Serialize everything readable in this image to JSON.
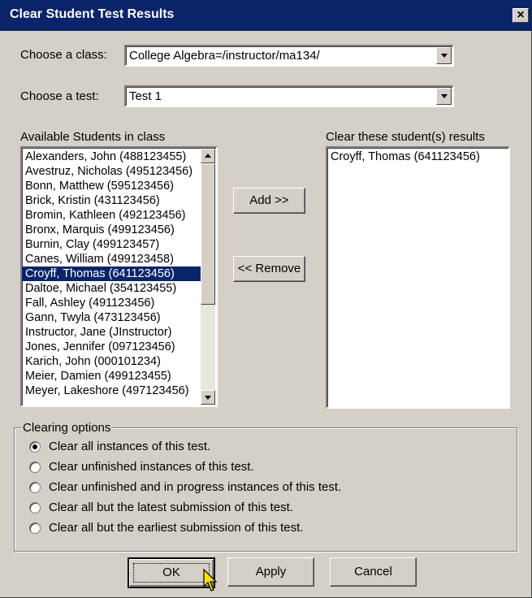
{
  "window": {
    "title": "Clear Student Test Results",
    "close_glyph": "×"
  },
  "class_select": {
    "label": "Choose a class:",
    "value": "College Algebra=/instructor/ma134/"
  },
  "test_select": {
    "label": "Choose a test:",
    "value": "Test 1"
  },
  "available": {
    "heading": "Available Students in class",
    "items": [
      "Alexanders, John (488123455)",
      "Avestruz, Nicholas (495123456)",
      "Bonn, Matthew (595123456)",
      "Brick, Kristin (431123456)",
      "Bromin, Kathleen (492123456)",
      "Bronx, Marquis (499123456)",
      "Burnin, Clay (499123457)",
      "Canes, William (499123458)",
      "Croyff, Thomas (641123456)",
      "Daltoe, Michael (354123455)",
      "Fall, Ashley (491123456)",
      "Gann, Twyla (473123456)",
      "Instructor, Jane (JInstructor)",
      "Jones, Jennifer (097123456)",
      "Karich, John (000101234)",
      "Meier, Damien (499123455)",
      "Meyer, Lakeshore (497123456)"
    ],
    "selected": "Croyff, Thomas (641123456)"
  },
  "clear_list": {
    "heading": "Clear these student(s) results",
    "items": [
      "Croyff, Thomas (641123456)"
    ]
  },
  "buttons": {
    "add": "Add >>",
    "remove": "<< Remove",
    "ok": "OK",
    "apply": "Apply",
    "cancel": "Cancel"
  },
  "options": {
    "legend": "Clearing options",
    "items": [
      {
        "label": "Clear all instances of this test.",
        "checked": true
      },
      {
        "label": "Clear unfinished instances of this test.",
        "checked": false
      },
      {
        "label": "Clear unfinished and in progress instances of this test.",
        "checked": false
      },
      {
        "label": "Clear all but the latest submission of this test.",
        "checked": false
      },
      {
        "label": "Clear all but the earliest submission of this test.",
        "checked": false
      }
    ]
  },
  "colors": {
    "titlebar": "#0a246a",
    "face": "#d4d0c8",
    "selection": "#0a246a"
  }
}
